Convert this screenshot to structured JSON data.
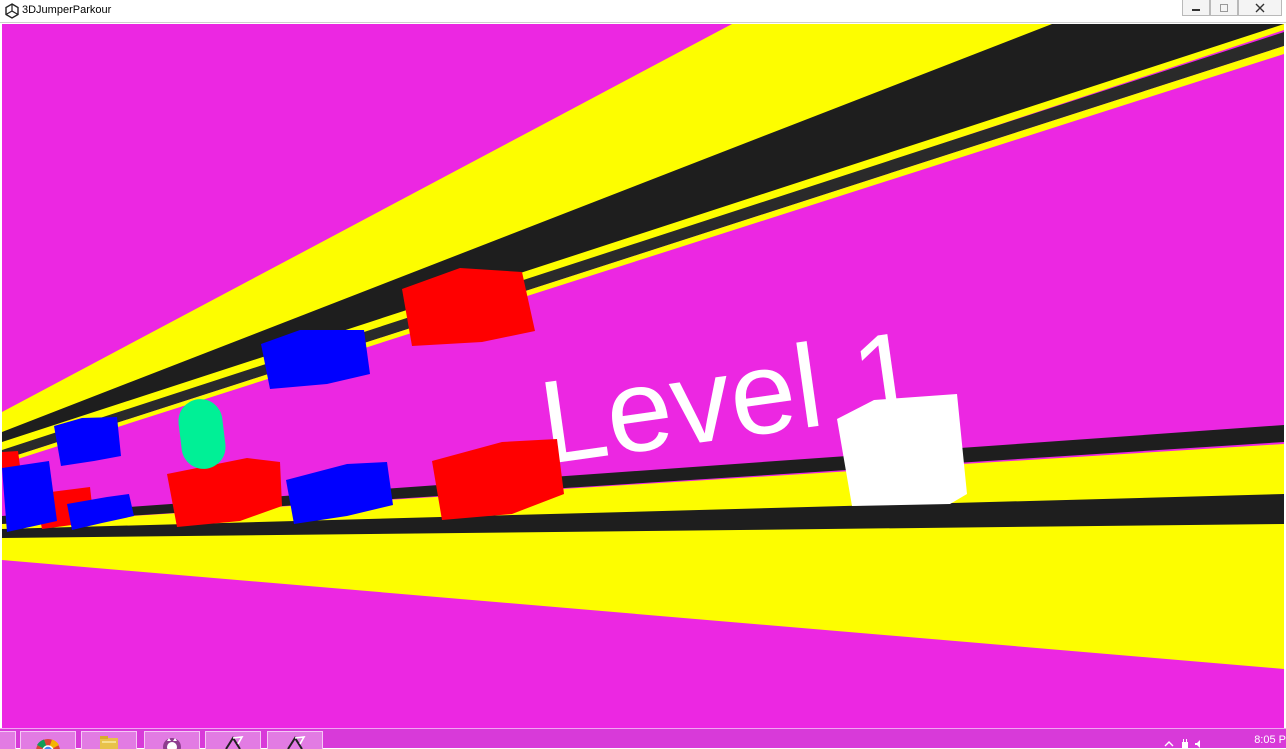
{
  "window": {
    "title": "3DJumperParkour",
    "icon": "unity-logo-icon",
    "controls": [
      "minimize",
      "maximize",
      "close"
    ]
  },
  "game": {
    "level_text": "Level 1",
    "colors": {
      "background": "#ec27e2",
      "track_yellow": "#fdfd00",
      "edge_dark": "#1e1e1e",
      "block_red": "#ff0000",
      "block_blue": "#0000ff",
      "capsule": "#00f096",
      "player": "#ffffff"
    }
  },
  "taskbar": {
    "apps": [
      {
        "name": "start-button",
        "icon": "windows-logo-icon"
      },
      {
        "name": "chrome",
        "icon": "chrome-icon"
      },
      {
        "name": "file-explorer",
        "icon": "folder-icon"
      },
      {
        "name": "github-desktop",
        "icon": "github-icon"
      },
      {
        "name": "unity-editor",
        "icon": "unity-logo-icon"
      },
      {
        "name": "unity-player",
        "icon": "unity-logo-icon"
      }
    ],
    "tray": {
      "clock": "8:05 P"
    }
  }
}
